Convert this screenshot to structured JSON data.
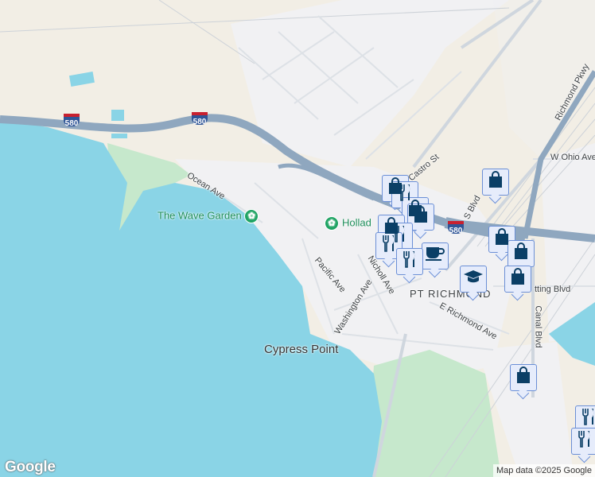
{
  "colors": {
    "water": "#8ad4e6",
    "land": "#f2eee5",
    "urban": "#f1f1f3",
    "park": "#c6e8cc",
    "highway": "#8fa7bf",
    "marker_fg": "#0b3f66",
    "marker_bg": "#e6ecfb"
  },
  "streets": {
    "ocean_ave": "Ocean Ave",
    "pacific_ave": "Pacific Ave",
    "nicholl_ave": "Nicholl Ave",
    "washington_ave": "Washington Ave",
    "e_richmond_ave": "E Richmond Ave",
    "canal_blvd": "Canal Blvd",
    "cutting_blvd": "tting Blvd",
    "w_ohio_ave": "W Ohio Ave",
    "richmond_pkwy": "Richmond Pkwy",
    "s_blvd": "S     Blvd",
    "castro_st": "Castro St"
  },
  "places": {
    "wave_garden": "The Wave Garden",
    "holland": "Hollad",
    "cypress_point": "Cypress Point",
    "pt_richmond": "PT RICHMOND"
  },
  "shields": [
    "580",
    "580",
    "580"
  ],
  "markers": [
    "shopping",
    "restaurant",
    "shopping",
    "shopping",
    "shopping",
    "restaurant",
    "restaurant",
    "cafe",
    "restaurant",
    "school",
    "shopping",
    "shopping",
    "shopping",
    "shopping",
    "shopping",
    "restaurant",
    "restaurant"
  ],
  "footer": {
    "logo": "Google",
    "attribution": "Map data ©2025 Google"
  }
}
